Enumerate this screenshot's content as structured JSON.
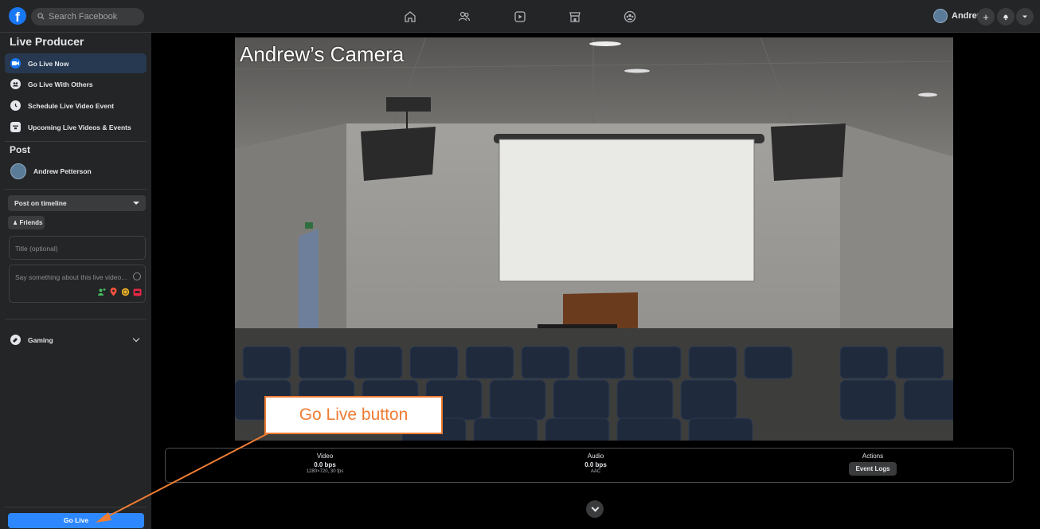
{
  "topbar": {
    "search_placeholder": "Search Facebook",
    "user_name": "Andrew",
    "nav_icons": [
      "home-icon",
      "friends-icon",
      "watch-icon",
      "marketplace-icon",
      "groups-icon"
    ]
  },
  "sidebar": {
    "title": "Live Producer",
    "items": [
      {
        "label": "Go Live Now",
        "icon": "camera-icon",
        "active": true
      },
      {
        "label": "Go Live With Others",
        "icon": "people-icon"
      },
      {
        "label": "Schedule Live Video Event",
        "icon": "clock-icon"
      },
      {
        "label": "Upcoming Live Videos & Events",
        "icon": "calendar-icon"
      }
    ],
    "post_title": "Post",
    "profile_name": "Andrew Petterson",
    "post_location": "Post on timeline",
    "audience": "Friends",
    "title_placeholder": "Title (optional)",
    "description_placeholder": "Say something about this live video...",
    "gaming_label": "Gaming",
    "go_live_label": "Go Live"
  },
  "main": {
    "camera_label": "Andrew’s Camera",
    "stats": {
      "video_title": "Video",
      "video_bitrate": "0.0 bps",
      "video_detail": "1280×720, 30 fps",
      "audio_title": "Audio",
      "audio_bitrate": "0.0 bps",
      "audio_detail": "AAC",
      "actions_title": "Actions",
      "event_logs_label": "Event Logs"
    }
  },
  "annotation": {
    "callout_text": "Go Live button",
    "color": "#ee7c33"
  },
  "colors": {
    "accent": "#2d88ff",
    "surface": "#242526",
    "active_item": "#263951"
  }
}
